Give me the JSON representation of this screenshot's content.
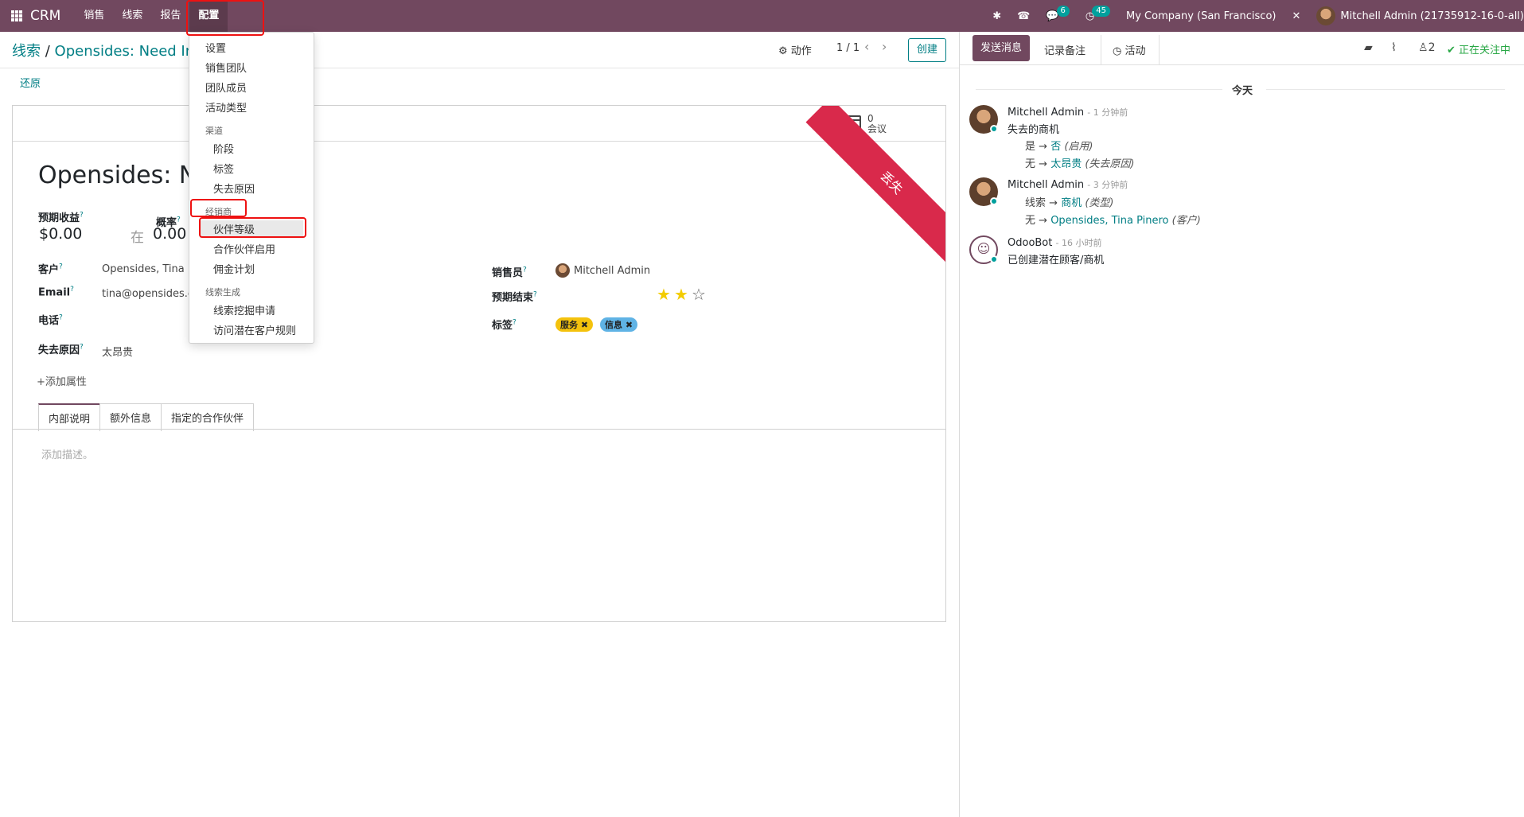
{
  "topbar": {
    "app_name": "CRM",
    "menus": [
      "销售",
      "线索",
      "报告",
      "配置"
    ],
    "messages_count": "6",
    "activities_count": "45",
    "company": "My Company (San Francisco)",
    "user": "Mitchell Admin (21735912-16-0-all)",
    "bar_color": "#71485f"
  },
  "control_panel": {
    "breadcrumb_root": "线索",
    "breadcrumb_current": "Opensides: Need Info",
    "breadcrumb_visible_head": "Opensides: Need Info",
    "breadcrumb_visible_tail": "l Info",
    "undo": "还原",
    "action": "动作",
    "pager": "1 / 1",
    "create": "创建"
  },
  "dropdown": {
    "items_top": [
      "设置",
      "销售团队",
      "团队成员",
      "活动类型"
    ],
    "section_pipeline": "渠道",
    "items_pipeline": [
      "阶段",
      "标签",
      "失去原因"
    ],
    "section_resellers": "经销商",
    "items_resellers": [
      "伙伴等级",
      "合作伙伴启用",
      "佣金计划"
    ],
    "section_leadgen": "线索生成",
    "items_leadgen": [
      "线索挖掘申请",
      "访问潜在客户规则"
    ]
  },
  "form": {
    "meeting_count": "0",
    "meeting_label": "会议",
    "ribbon": "丢失",
    "title": "Opensides: Ne",
    "expected_revenue_label": "预期收益",
    "expected_revenue": "$0.00",
    "probability_label": "概率",
    "probability_prefix": "在",
    "probability": "0.00",
    "customer_label": "客户",
    "customer": "Opensides, Tina P",
    "email_label": "Email",
    "email": "tina@opensides.e:",
    "phone_label": "电话",
    "lost_reason_label": "失去原因",
    "lost_reason": "太昂贵",
    "add_property": "添加属性",
    "salesperson_label": "销售员",
    "salesperson": "Mitchell Admin",
    "expected_close_label": "预期结束",
    "tags_label": "标签",
    "tags": [
      "服务",
      "信息"
    ],
    "priority_stars": "2 of 3",
    "tabs": [
      "内部说明",
      "额外信息",
      "指定的合作伙伴"
    ],
    "note_placeholder": "添加描述。"
  },
  "chatter": {
    "send_message": "发送消息",
    "log_note": "记录备注",
    "activity": "活动",
    "followers": "2",
    "following": "正在关注中",
    "today": "今天",
    "messages": [
      {
        "author": "Mitchell Admin",
        "time": "1 分钟前",
        "body": "失去的商机",
        "tracking": [
          {
            "old": "是",
            "new": "否",
            "field": "(启用)"
          },
          {
            "old": "无",
            "new": "太昂贵",
            "field": "(失去原因)"
          }
        ]
      },
      {
        "author": "Mitchell Admin",
        "time": "3 分钟前",
        "body": "",
        "tracking": [
          {
            "old": "线索",
            "new": "商机",
            "field": "(类型)"
          },
          {
            "old": "无",
            "new": "Opensides, Tina Pinero",
            "field": "(客户)"
          }
        ]
      },
      {
        "author": "OdooBot",
        "time": "16 小时前",
        "body": "已创建潜在顾客/商机"
      }
    ]
  }
}
